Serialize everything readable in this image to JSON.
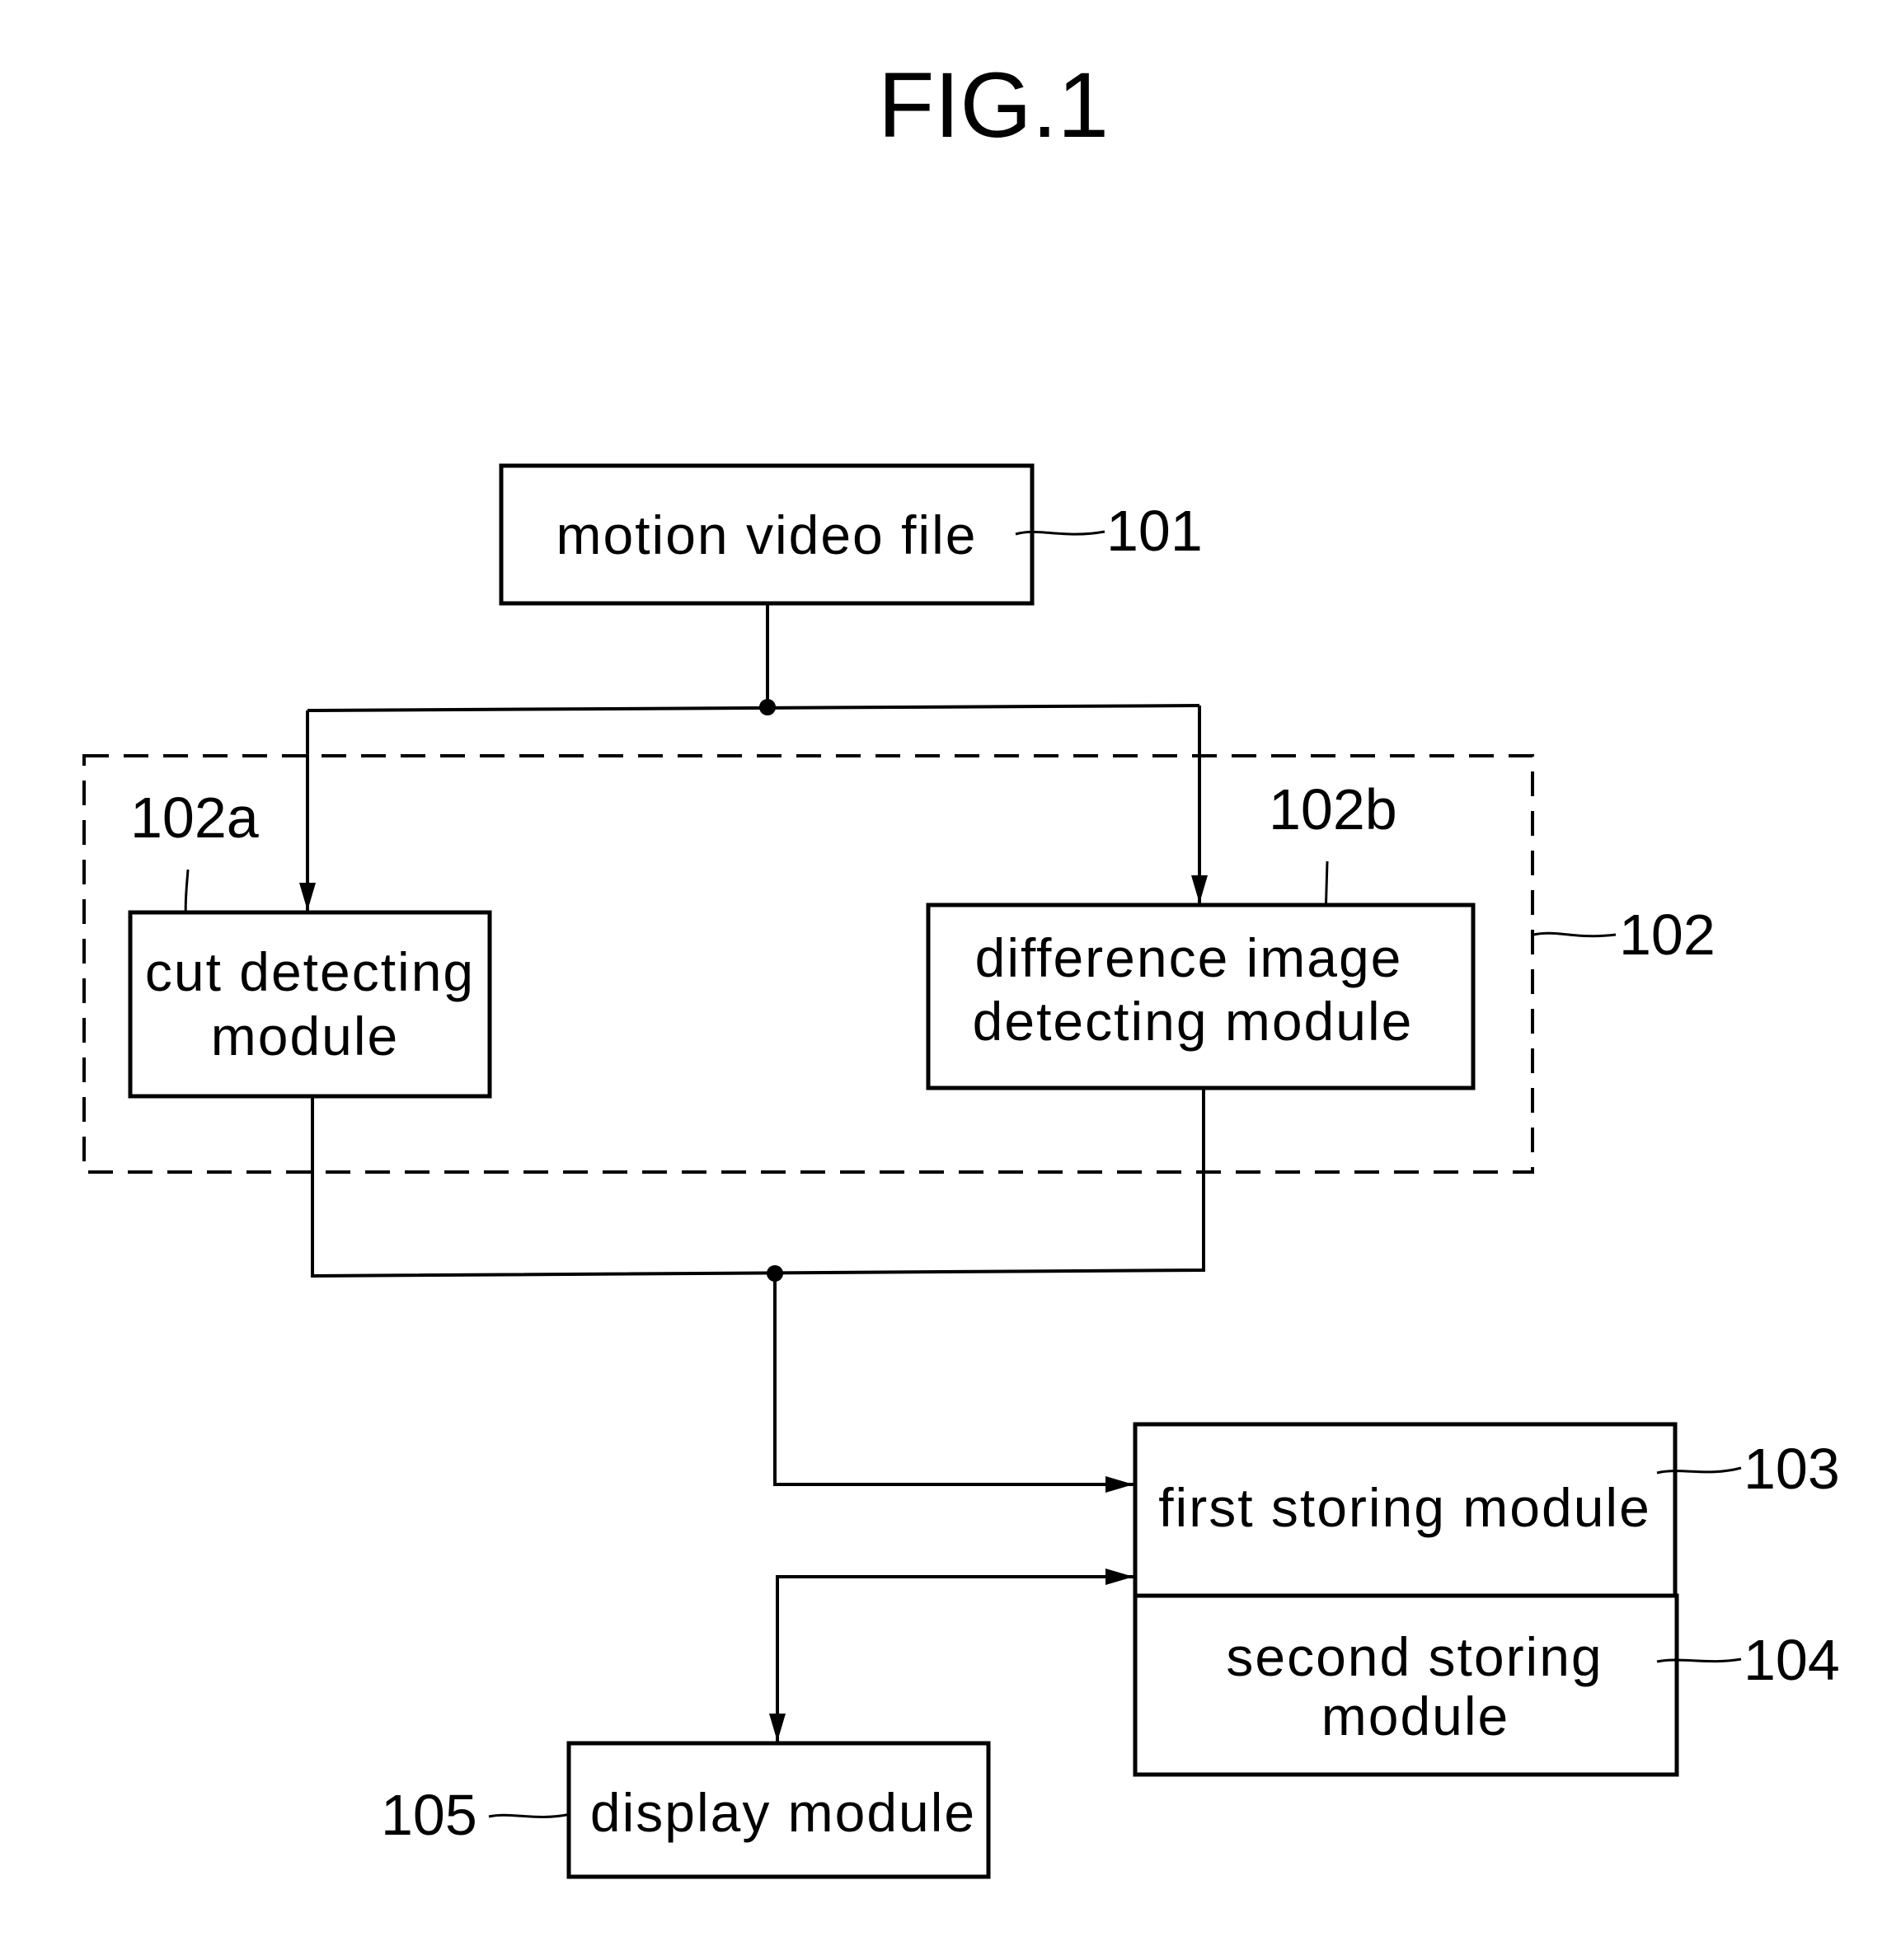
{
  "figure": {
    "title": "FIG.1"
  },
  "blocks": {
    "motion_video_file": {
      "label": "motion video file",
      "ref": "101"
    },
    "module_group": {
      "ref": "102"
    },
    "cut_detecting_module": {
      "line1": "cut detecting",
      "line2": "module",
      "ref": "102a"
    },
    "difference_image_detecting_module": {
      "line1": "difference image",
      "line2": "detecting module",
      "ref": "102b"
    },
    "first_storing_module": {
      "label": "first storing module",
      "ref": "103"
    },
    "second_storing_module": {
      "line1": "second storing",
      "line2": "module",
      "ref": "104"
    },
    "display_module": {
      "label": "display module",
      "ref": "105"
    }
  },
  "colors": {
    "ink": "#000000",
    "paper": "#ffffff"
  }
}
